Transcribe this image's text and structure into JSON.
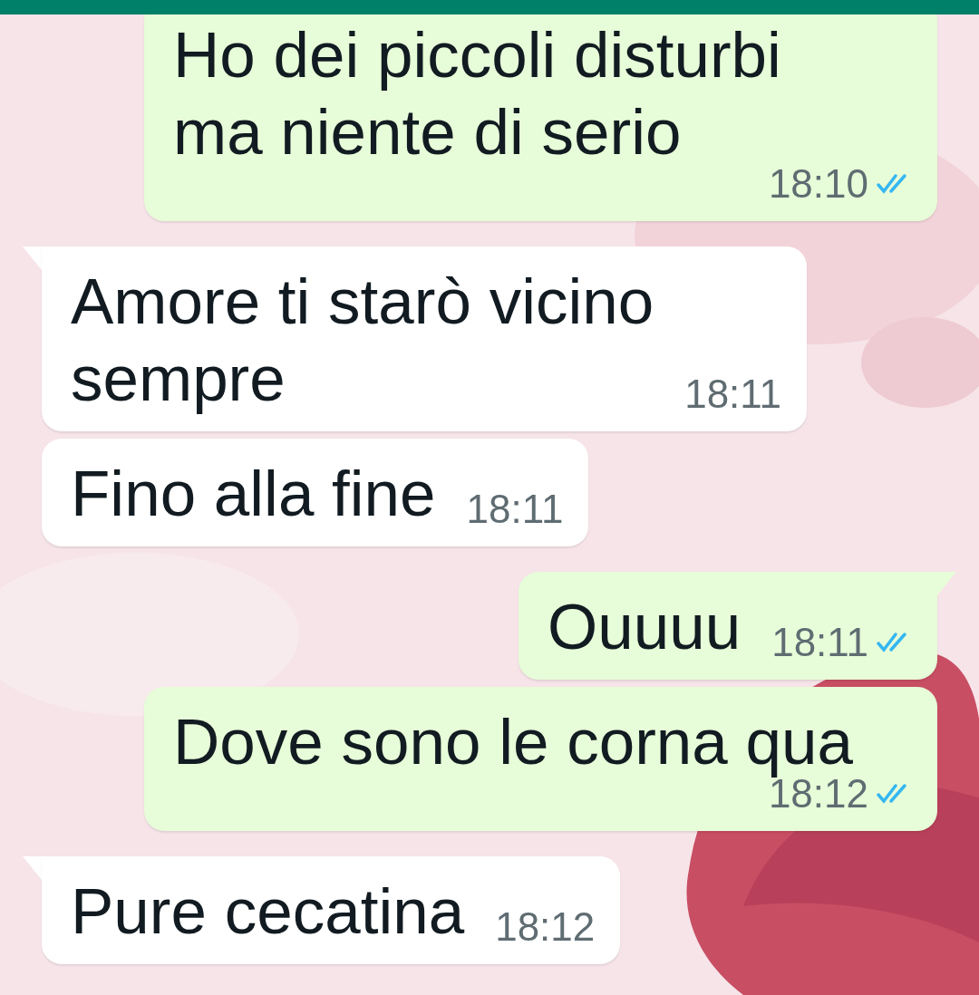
{
  "messages": [
    {
      "kind": "sent",
      "tail": false,
      "text": "Ho dei piccoli disturbi\nma niente di serio",
      "time": "18:10",
      "read": true
    },
    {
      "kind": "received",
      "tail": true,
      "text": "Amore ti starò vicino\nsempre",
      "time": "18:11"
    },
    {
      "kind": "received",
      "tail": false,
      "text": "Fino alla fine",
      "time": "18:11"
    },
    {
      "kind": "sent",
      "tail": true,
      "text": "Ouuuu",
      "time": "18:11",
      "read": true
    },
    {
      "kind": "sent",
      "tail": false,
      "text": "Dove sono le corna qua",
      "time": "18:12",
      "read": true
    },
    {
      "kind": "received",
      "tail": true,
      "text": "Pure cecatina",
      "time": "18:12"
    }
  ]
}
